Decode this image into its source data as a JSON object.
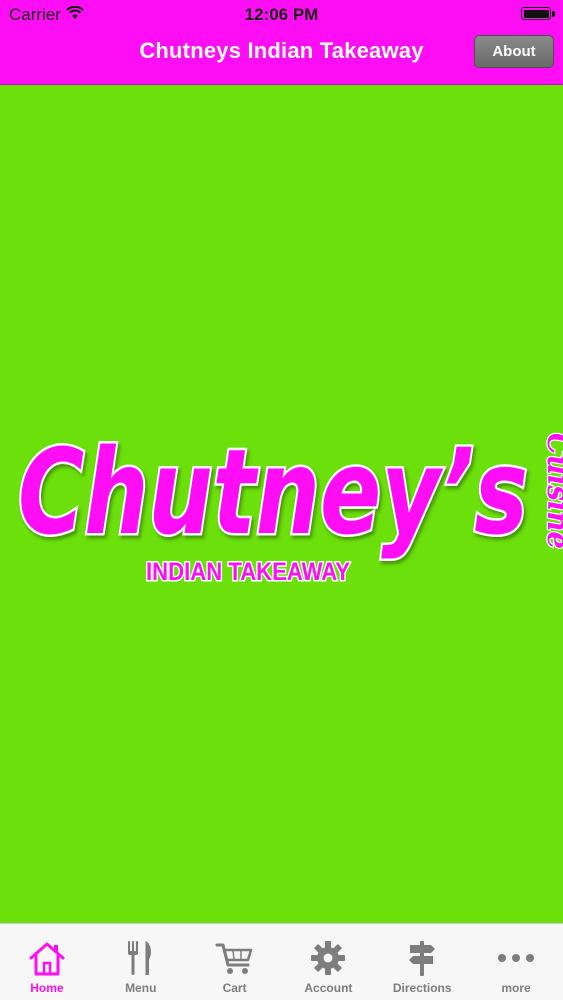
{
  "status_bar": {
    "carrier": "Carrier",
    "time": "12:06 PM"
  },
  "nav": {
    "title": "Chutneys Indian Takeaway",
    "about_label": "About"
  },
  "logo": {
    "name": "Chutney’s",
    "script": "Cuisine",
    "tagline": "INDIAN TAKEAWAY"
  },
  "tabs": [
    {
      "label": "Home",
      "icon": "home-icon",
      "active": true
    },
    {
      "label": "Menu",
      "icon": "fork-knife-icon",
      "active": false
    },
    {
      "label": "Cart",
      "icon": "cart-icon",
      "active": false
    },
    {
      "label": "Account",
      "icon": "gear-icon",
      "active": false
    },
    {
      "label": "Directions",
      "icon": "signpost-icon",
      "active": false
    },
    {
      "label": "more",
      "icon": "more-dots-icon",
      "active": false
    }
  ],
  "colors": {
    "brand_pink": "#ff0df5",
    "background_green": "#6be00b",
    "tab_inactive": "#7d7d7d"
  }
}
